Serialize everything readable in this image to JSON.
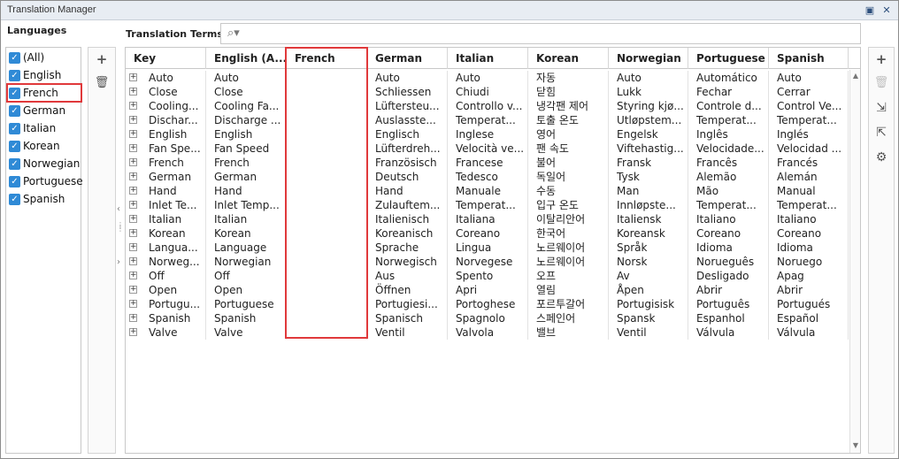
{
  "window": {
    "title": "Translation Manager",
    "restore_icon": "restore-icon",
    "close_icon": "close-icon"
  },
  "languages": {
    "header": "Languages",
    "items": [
      {
        "label": "(All)",
        "checked": true
      },
      {
        "label": "English",
        "checked": true
      },
      {
        "label": "French",
        "checked": true,
        "highlighted": true
      },
      {
        "label": "German",
        "checked": true
      },
      {
        "label": "Italian",
        "checked": true
      },
      {
        "label": "Korean",
        "checked": true
      },
      {
        "label": "Norwegian",
        "checked": true
      },
      {
        "label": "Portuguese",
        "checked": true
      },
      {
        "label": "Spanish",
        "checked": true
      }
    ]
  },
  "left_tools": {
    "add": "+",
    "delete": "🗑"
  },
  "terms": {
    "label": "Translation Terms",
    "search_placeholder": "",
    "columns": [
      "Key",
      "English (A...",
      "French",
      "German",
      "Italian",
      "Korean",
      "Norwegian",
      "Portuguese",
      "Spanish"
    ],
    "rows": [
      [
        "Auto",
        "Auto",
        "",
        "Auto",
        "Auto",
        "자동",
        "Auto",
        "Automático",
        "Auto"
      ],
      [
        "Close",
        "Close",
        "",
        "Schliessen",
        "Chiudi",
        "닫힘",
        "Lukk",
        "Fechar",
        "Cerrar"
      ],
      [
        "Cooling...",
        "Cooling Fa...",
        "",
        "Lüftersteu...",
        "Controllo v...",
        "냉각팬 제어",
        "Styring kjø...",
        "Controle d...",
        "Control Ve..."
      ],
      [
        "Dischar...",
        "Discharge ...",
        "",
        "Auslasste...",
        "Temperat...",
        "토출 온도",
        "Utløpstem...",
        "Temperat...",
        "Temperat..."
      ],
      [
        "English",
        "English",
        "",
        "Englisch",
        "Inglese",
        "영어",
        "Engelsk",
        "Inglês",
        "Inglés"
      ],
      [
        "Fan Spe...",
        "Fan Speed",
        "",
        "Lüfterdreh...",
        "Velocità ve...",
        "팬 속도",
        "Viftehastig...",
        "Velocidade...",
        "Velocidad ..."
      ],
      [
        "French",
        "French",
        "",
        "Französisch",
        "Francese",
        "불어",
        "Fransk",
        "Francês",
        "Francés"
      ],
      [
        "German",
        "German",
        "",
        "Deutsch",
        "Tedesco",
        "독일어",
        "Tysk",
        "Alemão",
        "Alemán"
      ],
      [
        "Hand",
        "Hand",
        "",
        "Hand",
        "Manuale",
        "수동",
        "Man",
        "Mão",
        "Manual"
      ],
      [
        "Inlet Te...",
        "Inlet Temp...",
        "",
        "Zulauftem...",
        "Temperat...",
        "입구 온도",
        "Innløpste...",
        "Temperat...",
        "Temperat..."
      ],
      [
        "Italian",
        "Italian",
        "",
        "Italienisch",
        "Italiana",
        "이탈리안어",
        "Italiensk",
        "Italiano",
        "Italiano"
      ],
      [
        "Korean",
        "Korean",
        "",
        "Koreanisch",
        "Coreano",
        "한국어",
        "Koreansk",
        "Coreano",
        "Coreano"
      ],
      [
        "Langua...",
        "Language",
        "",
        "Sprache",
        "Lingua",
        "노르웨이어",
        "Språk",
        "Idioma",
        "Idioma"
      ],
      [
        "Norweg...",
        "Norwegian",
        "",
        "Norwegisch",
        "Norvegese",
        "노르웨이어",
        "Norsk",
        "Norueguês",
        "Noruego"
      ],
      [
        "Off",
        "Off",
        "",
        "Aus",
        "Spento",
        "오프",
        "Av",
        "Desligado",
        "Apag"
      ],
      [
        "Open",
        "Open",
        "",
        "Öffnen",
        "Apri",
        "열림",
        "Åpen",
        "Abrir",
        "Abrir"
      ],
      [
        "Portugu...",
        "Portuguese",
        "",
        "Portugiesi...",
        "Portoghese",
        "포르투갈어",
        "Portugisisk",
        "Português",
        "Portugués"
      ],
      [
        "Spanish",
        "Spanish",
        "",
        "Spanisch",
        "Spagnolo",
        "스페인어",
        "Spansk",
        "Espanhol",
        "Español"
      ],
      [
        "Valve",
        "Valve",
        "",
        "Ventil",
        "Valvola",
        "밸브",
        "Ventil",
        "Válvula",
        "Válvula"
      ]
    ]
  },
  "right_tools": {
    "add": "+",
    "delete": "🗑",
    "import": "⇲",
    "export": "⇱",
    "settings": "⚙"
  },
  "colors": {
    "checkbox": "#2f8ad6",
    "highlight": "#e0393b",
    "titlebar": "#e8edf3"
  }
}
